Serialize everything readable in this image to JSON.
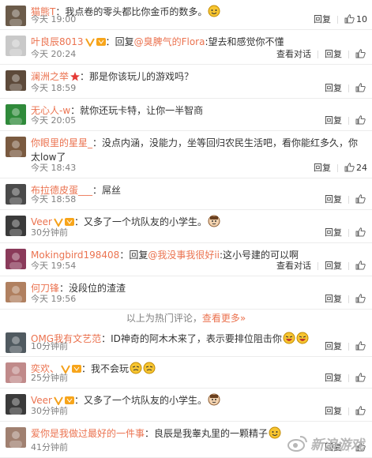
{
  "comments": [
    {
      "user": "猫熊T",
      "sep": "：",
      "pre": "",
      "mention": "",
      "text": "我点卷的零头都比你金币的数多。",
      "emoji": "smile",
      "time": "今天 19:00",
      "reply": "回复",
      "likes": "10",
      "conv": ""
    },
    {
      "user": "叶良辰8013",
      "sep": "：",
      "pre": "回复",
      "mention": "@臭脾气的Flora",
      "text": ":望去和感觉你不懂",
      "emoji": "",
      "time": "今天 20:24",
      "reply": "回复",
      "likes": "",
      "conv": "查看对话"
    },
    {
      "user": "澜洲之举",
      "sep": "：",
      "pre": "",
      "mention": "",
      "text": "那是你该玩儿的游戏吗？",
      "emoji": "",
      "time": "今天 18:59",
      "reply": "回复",
      "likes": "",
      "conv": ""
    },
    {
      "user": "无心人-w",
      "sep": "：",
      "pre": "",
      "mention": "",
      "text": "就你还玩卡特，让你一半智商",
      "emoji": "",
      "time": "今天 20:05",
      "reply": "回复",
      "likes": "",
      "conv": ""
    },
    {
      "user": "你眼里的星星_",
      "sep": "：",
      "pre": "",
      "mention": "",
      "text": "没点内涵，没能力，坐等回归农民生活吧，看你能红多久，你太low了",
      "emoji": "",
      "time": "今天 18:43",
      "reply": "回复",
      "likes": "24",
      "conv": ""
    },
    {
      "user": "布拉德皮蛋___",
      "sep": "：",
      "pre": "",
      "mention": "",
      "text": "屌丝",
      "emoji": "",
      "time": "今天 18:58",
      "reply": "回复",
      "likes": "",
      "conv": ""
    },
    {
      "user": "Veer",
      "sep": "：",
      "pre": "",
      "mention": "",
      "text": "又多了一个坑队友的小学生。",
      "emoji": "face",
      "time": "30分钟前",
      "reply": "回复",
      "likes": "",
      "conv": ""
    },
    {
      "user": "Mokingbird198408",
      "sep": "：",
      "pre": "回复",
      "mention": "@我没事我很好ii",
      "text": ":这小号建的可以啊",
      "emoji": "",
      "time": "今天 19:54",
      "reply": "回复",
      "likes": "",
      "conv": "查看对话"
    },
    {
      "user": "何刀锋",
      "sep": "：",
      "pre": "",
      "mention": "",
      "text": "没段位的渣渣",
      "emoji": "",
      "time": "今天 19:56",
      "reply": "回复",
      "likes": "",
      "conv": ""
    },
    {
      "user": "OMG我有文艺范",
      "sep": "：",
      "pre": "",
      "mention": "",
      "text": "ID神奇的阿木木来了，表示要排位阻击你",
      "emoji": "laugh2",
      "time": "10分钟前",
      "reply": "回复",
      "likes": "",
      "conv": ""
    },
    {
      "user": "奕欢、",
      "sep": "：",
      "pre": "",
      "mention": "",
      "text": "我不会玩",
      "emoji": "gold2",
      "time": "25分钟前",
      "reply": "回复",
      "likes": "",
      "conv": ""
    },
    {
      "user": "Veer",
      "sep": "：",
      "pre": "",
      "mention": "",
      "text": "又多了一个坑队友的小学生。",
      "emoji": "face",
      "time": "30分钟前",
      "reply": "回复",
      "likes": "",
      "conv": ""
    },
    {
      "user": "爱你是我做过最好的一件事",
      "sep": "：",
      "pre": "",
      "mention": "",
      "text": "良辰是我睾丸里的一颗精子",
      "emoji": "smile",
      "time": "41分钟前",
      "reply": "回复",
      "likes": "",
      "conv": ""
    }
  ],
  "divider": {
    "text": "以上为热门评论，",
    "more": "查看更多»"
  },
  "watermark": {
    "text": "新浪游戏"
  },
  "colors": {
    "accent": "#eb7350",
    "meta": "#808080",
    "text": "#333333"
  }
}
